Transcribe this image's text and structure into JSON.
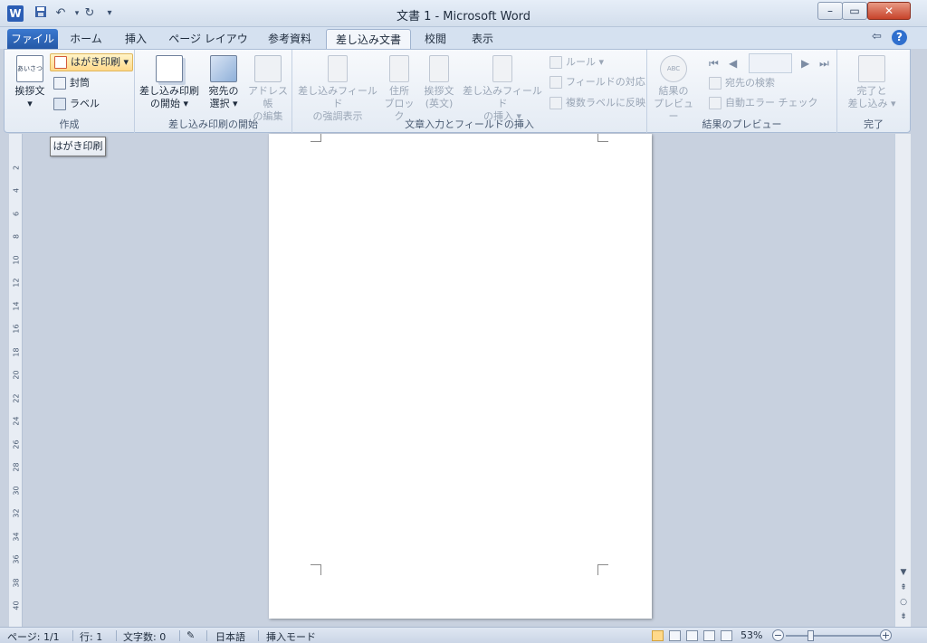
{
  "window": {
    "title": "文書 1 - Microsoft Word",
    "app_letter": "W"
  },
  "quick_access": {
    "save_icon": "save-icon",
    "undo_icon": "undo-icon",
    "redo_icon": "redo-icon",
    "customize_icon": "chevron-down-icon"
  },
  "tabs": [
    {
      "label": "ファイル"
    },
    {
      "label": "ホーム"
    },
    {
      "label": "挿入"
    },
    {
      "label": "ページ レイアウト"
    },
    {
      "label": "参考資料"
    },
    {
      "label": "差し込み文書"
    },
    {
      "label": "校閲"
    },
    {
      "label": "表示"
    }
  ],
  "ribbon": {
    "create": {
      "label": "作成",
      "greeting": "挨拶文",
      "greeting_icon_text": "あいさつ",
      "postcard": "はがき印刷",
      "envelope": "封筒",
      "labels": "ラベル"
    },
    "start_merge": {
      "label": "差し込み印刷の開始",
      "start_line1": "差し込み印刷",
      "start_line2": "の開始",
      "select_line1": "宛先の",
      "select_line2": "選択",
      "edit_line1": "アドレス帳",
      "edit_line2": "の編集"
    },
    "write_insert": {
      "label": "文章入力とフィールドの挿入",
      "highlight_line1": "差し込みフィールド",
      "highlight_line2": "の強調表示",
      "address_line1": "住所",
      "address_line2": "ブロック",
      "greeting_line1": "挨拶文",
      "greeting_line2": "(英文)",
      "insert_line1": "差し込みフィールド",
      "insert_line2": "の挿入",
      "rules": "ルール",
      "match_fields": "フィールドの対応",
      "update_labels": "複数ラベルに反映"
    },
    "preview": {
      "label": "結果のプレビュー",
      "preview_line1": "結果の",
      "preview_line2": "プレビュー",
      "preview_icon_text": "ABC",
      "find_recipient": "宛先の検索",
      "auto_check": "自動エラー チェック"
    },
    "finish": {
      "label": "完了",
      "finish_line1": "完了と",
      "finish_line2": "差し込み"
    }
  },
  "tooltip": "はがき印刷",
  "ruler_numbers": [
    "2",
    "4",
    "6",
    "8",
    "10",
    "12",
    "14",
    "16",
    "18",
    "20",
    "22",
    "24",
    "26",
    "28",
    "30",
    "32",
    "34",
    "36",
    "38",
    "40"
  ],
  "status": {
    "page": "ページ: 1/1",
    "line": "行: 1",
    "chars": "文字数: 0",
    "language": "日本語",
    "mode": "挿入モード",
    "zoom": "53%"
  },
  "colors": {
    "accent": "#2b5eb5",
    "file_tab": "#2a61b3",
    "highlight": "#ffd98a"
  }
}
